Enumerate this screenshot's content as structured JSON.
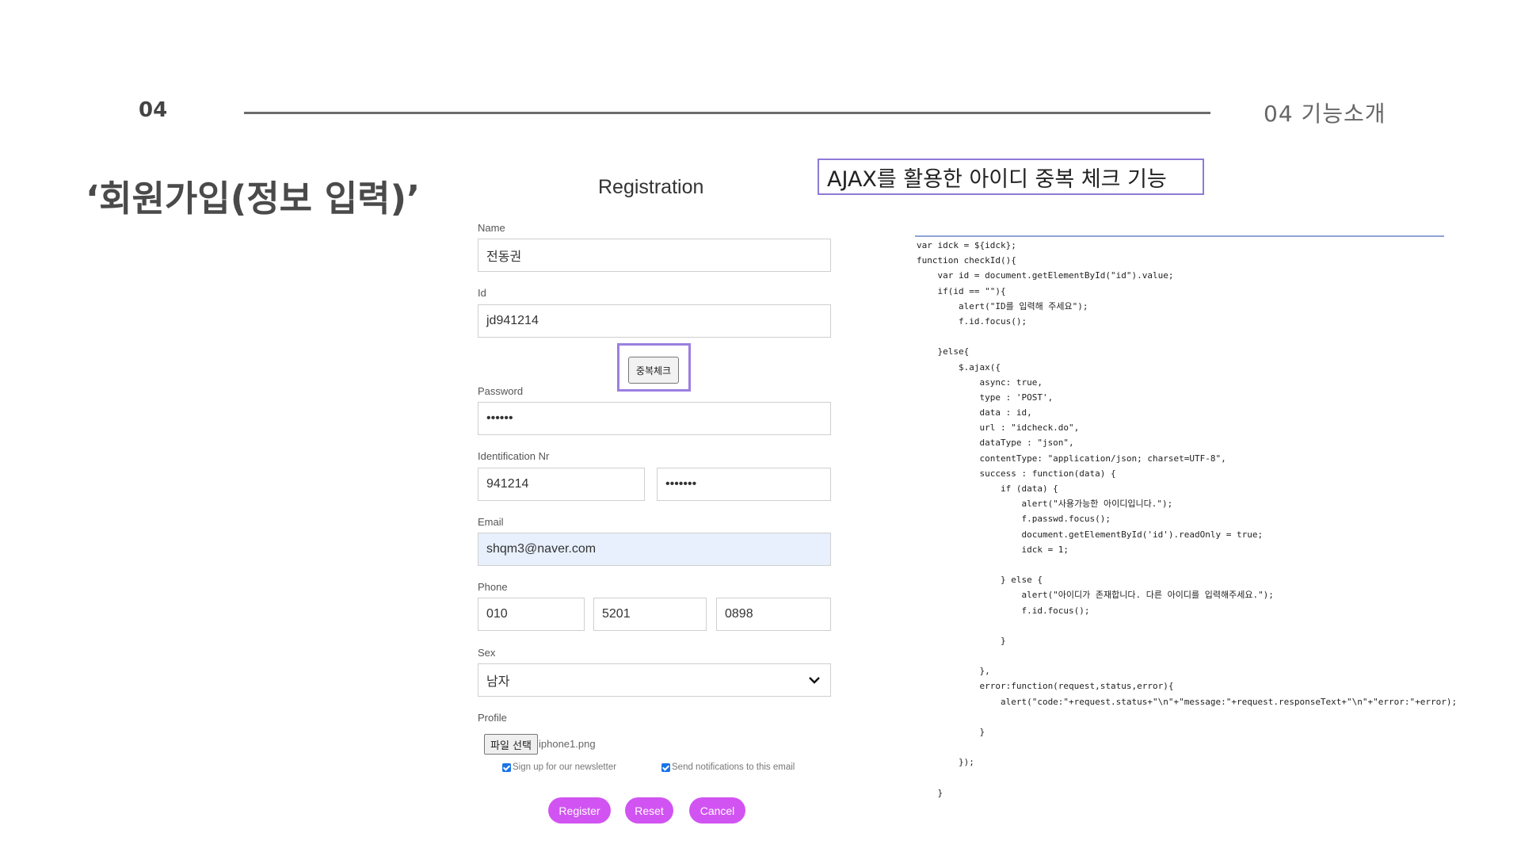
{
  "header": {
    "section_number": "04",
    "section_title": "04  기능소개",
    "page_title": "‘회원가입(정보 입력)’"
  },
  "form": {
    "title": "Registration",
    "name_label": "Name",
    "name_value": "전동권",
    "id_label": "Id",
    "id_value": "jd941214",
    "dup_check_button": "중복체크",
    "password_label": "Password",
    "password_value": "••••••",
    "idnr_label": "Identification Nr",
    "idnr_front": "941214",
    "idnr_back": "•••••••",
    "email_label": "Email",
    "email_value": "shqm3@naver.com",
    "phone_label": "Phone",
    "phone_1": "010",
    "phone_2": "5201",
    "phone_3": "0898",
    "sex_label": "Sex",
    "sex_value": "남자",
    "profile_label": "Profile",
    "file_button": "파일 선택",
    "file_name": "iphone1.png",
    "newsletter_label": "Sign up for our newsletter",
    "notify_label": "Send notifications to this email",
    "register_button": "Register",
    "reset_button": "Reset",
    "cancel_button": "Cancel"
  },
  "ajax_caption": "AJAX를 활용한 아이디 중복 체크 기능",
  "code_lines": [
    "var idck = ${idck};",
    "function checkId(){",
    "    var id = document.getElementById(\"id\").value;",
    "    if(id == \"\"){",
    "        alert(\"ID를 입력해 주세요\");",
    "        f.id.focus();",
    "",
    "    }else{",
    "        $.ajax({",
    "            async: true,",
    "            type : 'POST',",
    "            data : id,",
    "            url : \"idcheck.do\",",
    "            dataType : \"json\",",
    "            contentType: \"application/json; charset=UTF-8\",",
    "            success : function(data) {",
    "                if (data) {",
    "                    alert(\"사용가능한 아이디입니다.\");",
    "                    f.passwd.focus();",
    "                    document.getElementById('id').readOnly = true;",
    "                    idck = 1;",
    "",
    "                } else {",
    "                    alert(\"아이디가 존재합니다. 다른 아이디를 입력해주세요.\");",
    "                    f.id.focus();",
    "",
    "                }",
    "",
    "            },",
    "            error:function(request,status,error){",
    "                alert(\"code:\"+request.status+\"\\n\"+\"message:\"+request.responseText+\"\\n\"+\"error:\"+error);",
    "",
    "            }",
    "",
    "        });",
    "",
    "    }"
  ],
  "colors": {
    "accent_button": "#d154f2",
    "highlight_border": "#9b7fe0",
    "email_fill": "#e8f0fe"
  }
}
